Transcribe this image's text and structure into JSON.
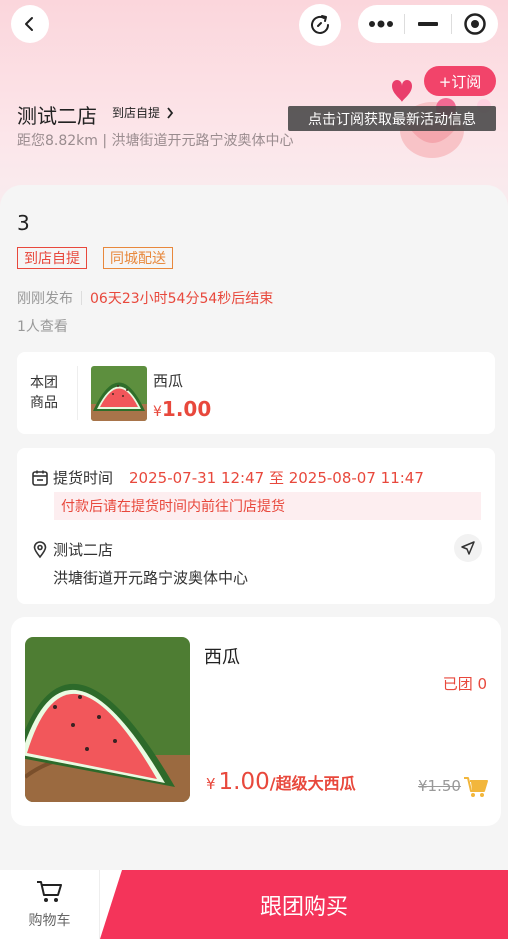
{
  "header": {
    "store_name": "测试二店",
    "pickup_tag": "到店自提",
    "distance_address": "距您8.82km | 洪塘街道开元路宁波奥体中心",
    "subscribe_label": "+订阅",
    "subscribe_tip": "点击订阅获取最新活动信息"
  },
  "group": {
    "title": "3",
    "tags": [
      "到店自提",
      "同城配送"
    ],
    "published": "刚刚发布",
    "countdown": "06天23小时54分54秒后结束",
    "views": "1人查看"
  },
  "product_card": {
    "label": "本团商品",
    "name": "西瓜",
    "currency": "¥",
    "price": "1.00"
  },
  "pickup": {
    "time_label": "提货时间",
    "time_range": "2025-07-31 12:47 至 2025-08-07 11:47",
    "hint": "付款后请在提货时间内前往门店提货",
    "store": "测试二店",
    "address": "洪塘街道开元路宁波奥体中心"
  },
  "item": {
    "name": "西瓜",
    "joined": "已团 0",
    "currency": "¥",
    "price": "1.00",
    "spec": "/超级大西瓜",
    "original_price": "¥1.50"
  },
  "footer": {
    "cart_label": "购物车",
    "buy_label": "跟团购买"
  },
  "colors": {
    "accent": "#e8483c",
    "brand": "#f2446a"
  },
  "icons": [
    "back-icon",
    "refresh-icon",
    "more-icon",
    "minimize-icon",
    "close-target-icon",
    "chevron-right-icon",
    "calendar-icon",
    "location-pin-icon",
    "navigate-icon",
    "cart-add-icon",
    "cart-icon"
  ]
}
